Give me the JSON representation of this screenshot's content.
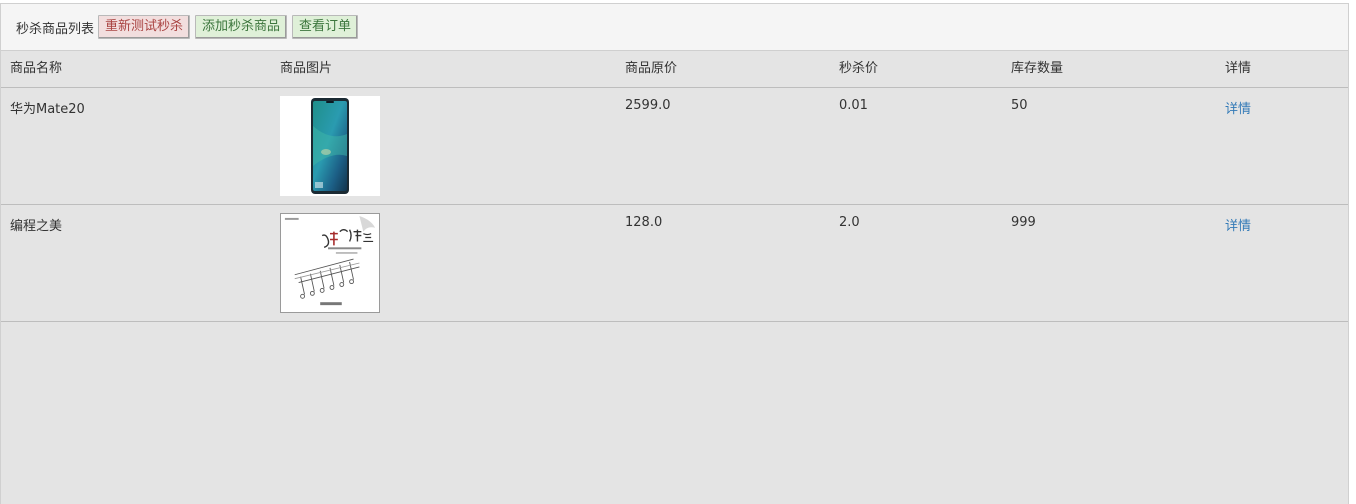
{
  "header": {
    "title": "秒杀商品列表",
    "buttons": {
      "reset_label": "重新测试秒杀",
      "add_label": "添加秒杀商品",
      "orders_label": "查看订单"
    }
  },
  "table": {
    "columns": [
      "商品名称",
      "商品图片",
      "商品原价",
      "秒杀价",
      "库存数量",
      "详情"
    ],
    "rows": [
      {
        "name": "华为Mate20",
        "image_icon": "phone-image",
        "original_price": "2599.0",
        "seckill_price": "0.01",
        "stock": "50",
        "detail_label": "详情"
      },
      {
        "name": "编程之美",
        "image_icon": "book-cover-image",
        "original_price": "128.0",
        "seckill_price": "2.0",
        "stock": "999",
        "detail_label": "详情"
      }
    ]
  },
  "colors": {
    "panel_background": "#e4e4e4",
    "heading_background": "#f5f5f5",
    "link": "#337ab7",
    "danger_text": "#a94442",
    "success_text": "#3c763d"
  }
}
